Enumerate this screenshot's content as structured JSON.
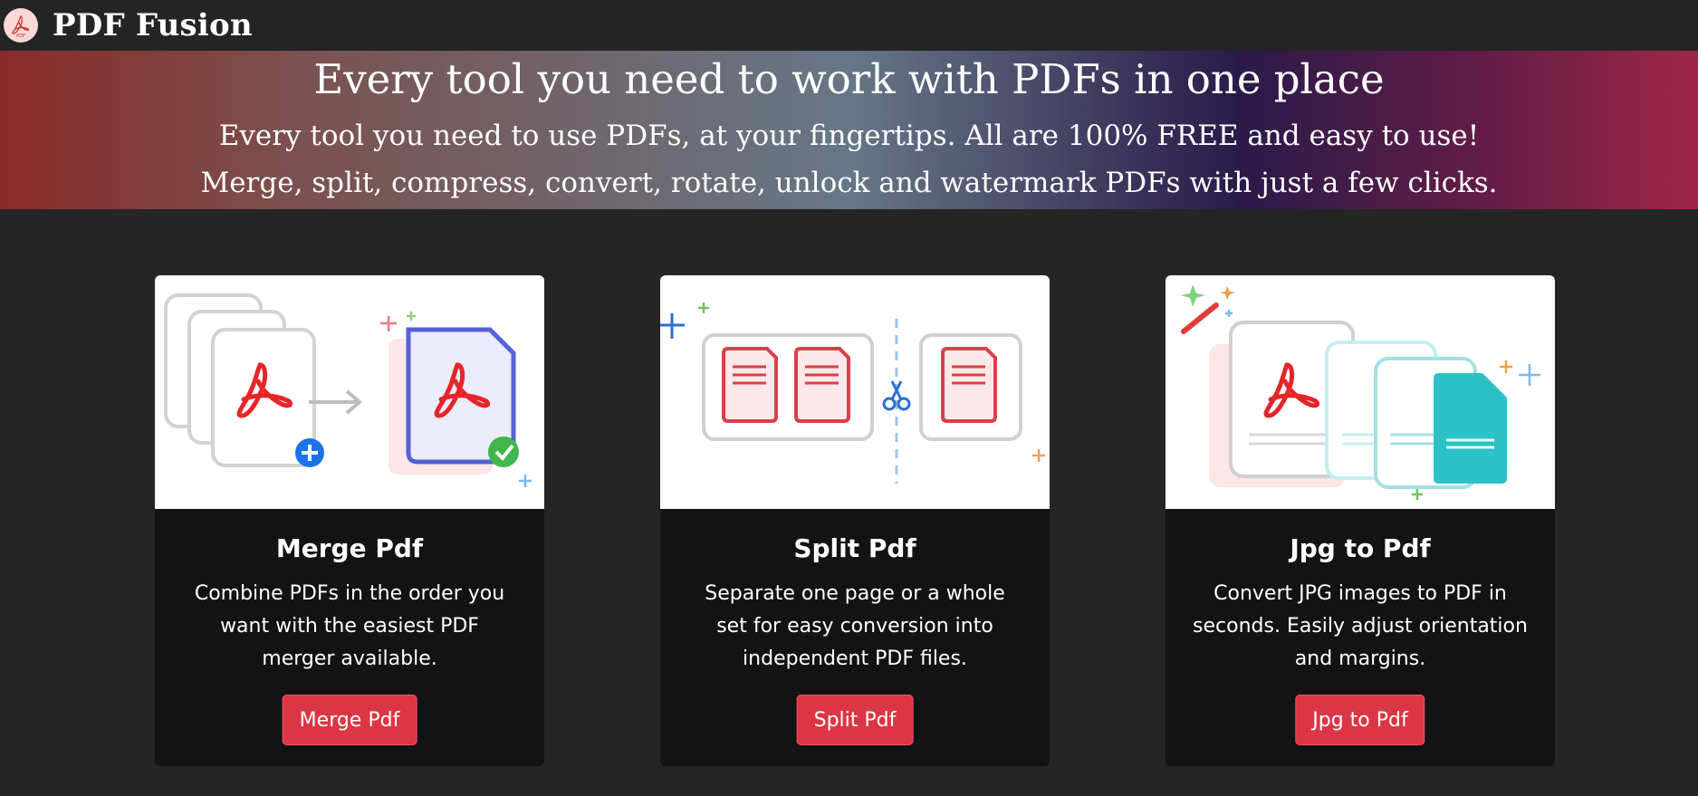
{
  "brand": {
    "name": "PDF Fusion",
    "logo_icon": "acrobat-logo-icon"
  },
  "hero": {
    "title": "Every tool you need to work with PDFs in one place",
    "subtitle_line1": "Every tool you need to use PDFs, at your fingertips. All are 100% FREE and easy to use!",
    "subtitle_line2": "Merge, split, compress, convert, rotate, unlock and watermark PDFs with just a few clicks."
  },
  "tools": [
    {
      "title": "Merge Pdf",
      "description": "Combine PDFs in the order you want with the easiest PDF merger available.",
      "button_label": "Merge Pdf",
      "illustration": "merge-pdf-illustration"
    },
    {
      "title": "Split Pdf",
      "description": "Separate one page or a whole set for easy conversion into independent PDF files.",
      "button_label": "Split Pdf",
      "illustration": "split-pdf-illustration"
    },
    {
      "title": "Jpg to Pdf",
      "description": "Convert JPG images to PDF in seconds. Easily adjust orientation and margins.",
      "button_label": "Jpg to Pdf",
      "illustration": "jpg-to-pdf-illustration"
    }
  ],
  "colors": {
    "background": "#252525",
    "card_background": "#131313",
    "button": "#dc3545",
    "acrobat_red": "#e5252a"
  }
}
